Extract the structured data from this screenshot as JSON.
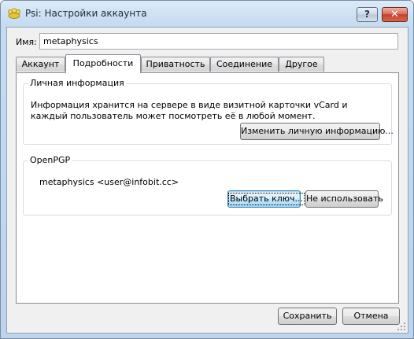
{
  "window": {
    "title": "Psi: Настройки аккаунта",
    "help_glyph": "?",
    "close_glyph": "✕",
    "app_icon": "psi-flower-icon"
  },
  "account": {
    "name_label": "Имя:",
    "name_value": "metaphysics"
  },
  "tabs": [
    {
      "label": "Аккаунт",
      "active": false
    },
    {
      "label": "Подробности",
      "active": true
    },
    {
      "label": "Приватность",
      "active": false
    },
    {
      "label": "Соединение",
      "active": false
    },
    {
      "label": "Другое",
      "active": false
    }
  ],
  "personal_info": {
    "title": "Личная информация",
    "text": "Информация хранится на сервере в виде визитной карточки vCard и каждый пользователь может посмотреть её в любой момент.",
    "edit_button": "Изменить личную информацию..."
  },
  "openpgp": {
    "title": "OpenPGP",
    "key_text": "metaphysics <user@infobit.cc>",
    "choose_key_button": "Выбрать ключ...",
    "dont_use_button": "Не использовать"
  },
  "footer": {
    "save_button": "Сохранить",
    "cancel_button": "Отмена"
  }
}
